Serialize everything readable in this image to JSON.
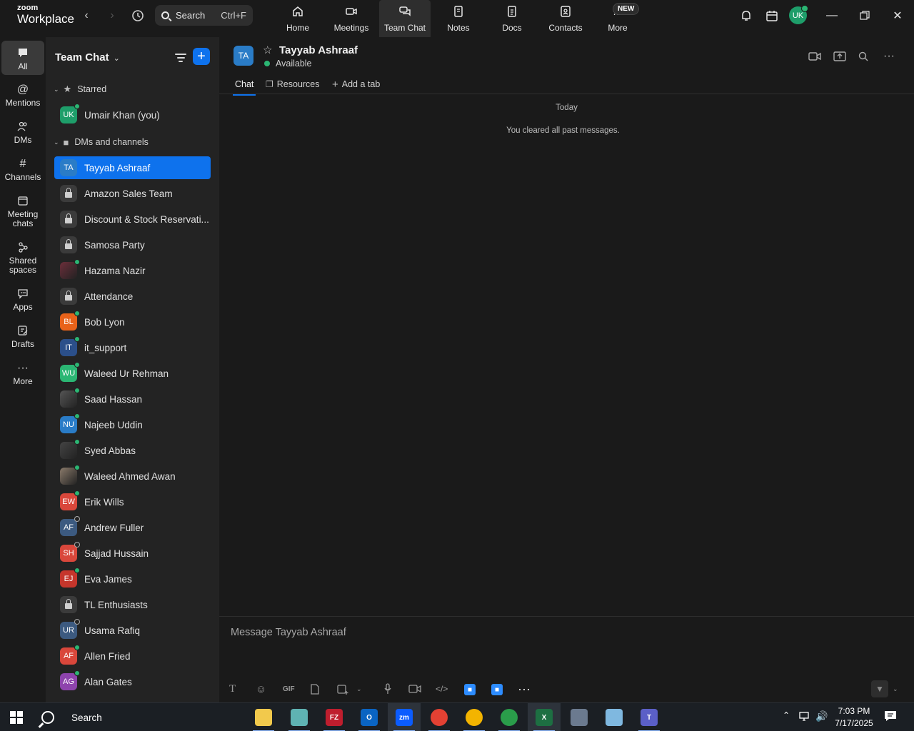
{
  "app": {
    "logo_small": "zoom",
    "logo_big": "Workplace"
  },
  "topbar": {
    "search_label": "Search",
    "search_shortcut": "Ctrl+F",
    "nav": [
      {
        "label": "Home",
        "icon": "home-icon"
      },
      {
        "label": "Meetings",
        "icon": "video-camera-icon"
      },
      {
        "label": "Team Chat",
        "icon": "chat-bubbles-icon"
      },
      {
        "label": "Notes",
        "icon": "notes-icon"
      },
      {
        "label": "Docs",
        "icon": "document-icon"
      },
      {
        "label": "Contacts",
        "icon": "contact-card-icon"
      },
      {
        "label": "More",
        "icon": "more-dots-icon"
      }
    ],
    "new_badge": "NEW",
    "user_initials": "UK"
  },
  "rail": {
    "items": [
      {
        "label": "All",
        "icon": "chat-icon"
      },
      {
        "label": "Mentions",
        "icon": "at-icon"
      },
      {
        "label": "DMs",
        "icon": "people-icon"
      },
      {
        "label": "Channels",
        "icon": "hash-icon"
      },
      {
        "label": "Meeting chats",
        "icon": "calendar-icon"
      },
      {
        "label": "Shared spaces",
        "icon": "shared-spaces-icon"
      },
      {
        "label": "Apps",
        "icon": "apps-icon"
      },
      {
        "label": "Drafts",
        "icon": "drafts-icon"
      },
      {
        "label": "More",
        "icon": "more-icon"
      }
    ]
  },
  "sidebar": {
    "title": "Team Chat",
    "starred_label": "Starred",
    "dms_label": "DMs and channels",
    "starred": [
      {
        "name": "Umair Khan (you)",
        "initials": "UK",
        "color": "#1e9e6a",
        "status": "online"
      }
    ],
    "items": [
      {
        "name": "Tayyab Ashraaf",
        "initials": "TA",
        "color": "#2a7cc7",
        "status": "none",
        "type": "dm"
      },
      {
        "name": "Amazon Sales Team",
        "initials": "",
        "color": "#3b3b3b",
        "status": "none",
        "type": "locked"
      },
      {
        "name": "Discount & Stock Reservati...",
        "initials": "",
        "color": "#3b3b3b",
        "status": "none",
        "type": "locked"
      },
      {
        "name": "Samosa Party",
        "initials": "",
        "color": "#3b3b3b",
        "status": "none",
        "type": "locked"
      },
      {
        "name": "Hazama Nazir",
        "initials": "",
        "color": "#6b2e3a",
        "status": "online",
        "type": "photo"
      },
      {
        "name": "Attendance",
        "initials": "",
        "color": "#3b3b3b",
        "status": "none",
        "type": "locked"
      },
      {
        "name": "Bob Lyon",
        "initials": "BL",
        "color": "#e8621a",
        "status": "online",
        "type": "dm"
      },
      {
        "name": "it_support",
        "initials": "IT",
        "color": "#2b4f8a",
        "status": "online",
        "type": "dm"
      },
      {
        "name": "Waleed Ur Rehman",
        "initials": "WU",
        "color": "#2bb673",
        "status": "online",
        "type": "dm"
      },
      {
        "name": "Saad Hassan",
        "initials": "",
        "color": "#555555",
        "status": "online",
        "type": "photo"
      },
      {
        "name": "Najeeb Uddin",
        "initials": "NU",
        "color": "#2a7cc7",
        "status": "online",
        "type": "dm"
      },
      {
        "name": "Syed Abbas",
        "initials": "",
        "color": "#444444",
        "status": "online",
        "type": "photo"
      },
      {
        "name": "Waleed Ahmed Awan",
        "initials": "",
        "color": "#8a7a6a",
        "status": "online",
        "type": "photo"
      },
      {
        "name": "Erik Wills",
        "initials": "EW",
        "color": "#d9473b",
        "status": "online",
        "type": "dm"
      },
      {
        "name": "Andrew Fuller",
        "initials": "AF",
        "color": "#3c5a80",
        "status": "away",
        "type": "dm"
      },
      {
        "name": "Sajjad Hussain",
        "initials": "SH",
        "color": "#d9473b",
        "status": "away",
        "type": "dm"
      },
      {
        "name": "Eva James",
        "initials": "EJ",
        "color": "#c6362c",
        "status": "online",
        "type": "dm"
      },
      {
        "name": "TL Enthusiasts",
        "initials": "",
        "color": "#3b3b3b",
        "status": "none",
        "type": "locked"
      },
      {
        "name": "Usama Rafiq",
        "initials": "UR",
        "color": "#3c5a80",
        "status": "away",
        "type": "dm"
      },
      {
        "name": "Allen Fried",
        "initials": "AF",
        "color": "#d9473b",
        "status": "online",
        "type": "dm"
      },
      {
        "name": "Alan Gates",
        "initials": "AG",
        "color": "#8e44ad",
        "status": "online",
        "type": "dm"
      }
    ]
  },
  "chat": {
    "initials": "TA",
    "name": "Tayyab Ashraaf",
    "status": "Available",
    "tabs": [
      "Chat",
      "Resources",
      "Add a tab"
    ],
    "day_divider": "Today",
    "system_message": "You cleared all past messages.",
    "composer_placeholder": "Message Tayyab Ashraaf",
    "gif_label": "GIF"
  },
  "taskbar": {
    "search_label": "Search",
    "time": "7:03 PM",
    "date": "7/17/2025",
    "apps": [
      {
        "name": "file-explorer",
        "label": "",
        "color": "#f2c94c"
      },
      {
        "name": "app-diamond",
        "label": "",
        "color": "#5fb3b3"
      },
      {
        "name": "filezilla",
        "label": "FZ",
        "color": "#bf1e2e"
      },
      {
        "name": "outlook",
        "label": "O",
        "color": "#0a64c2"
      },
      {
        "name": "zoom",
        "label": "zm",
        "color": "#0b5cff"
      },
      {
        "name": "chrome-1",
        "label": "",
        "color": "#e34133"
      },
      {
        "name": "chrome-2",
        "label": "",
        "color": "#f3b400"
      },
      {
        "name": "chrome-3",
        "label": "",
        "color": "#2a9d4a"
      },
      {
        "name": "excel",
        "label": "X",
        "color": "#1d6f42"
      },
      {
        "name": "calculator",
        "label": "",
        "color": "#6b7a8f"
      },
      {
        "name": "notepad",
        "label": "",
        "color": "#7fb8e0"
      },
      {
        "name": "teams",
        "label": "T",
        "color": "#5b5fc7"
      }
    ]
  }
}
